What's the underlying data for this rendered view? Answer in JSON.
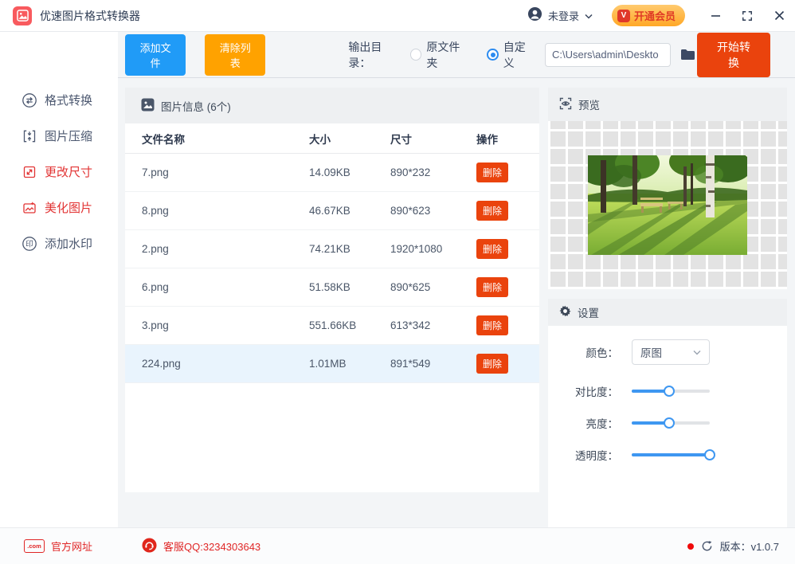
{
  "window": {
    "title": "优速图片格式转换器",
    "login_label": "未登录",
    "vip_label": "开通会员",
    "vip_icon_letter": "V"
  },
  "toolbar": {
    "add_files": "添加文件",
    "clear_list": "清除列表",
    "output_dir_label": "输出目录：",
    "radio_original": "原文件夹",
    "radio_custom": "自定义",
    "radio_selected": "自定义",
    "path_value": "C:\\Users\\admin\\Deskto",
    "start_button": "开始转换"
  },
  "sidebar": {
    "items": [
      {
        "label": "格式转换",
        "icon": "format-convert-icon",
        "highlighted": false
      },
      {
        "label": "图片压缩",
        "icon": "compress-icon",
        "highlighted": false
      },
      {
        "label": "更改尺寸",
        "icon": "resize-icon",
        "highlighted": true
      },
      {
        "label": "美化图片",
        "icon": "beautify-icon",
        "highlighted": true
      },
      {
        "label": "添加水印",
        "icon": "watermark-icon",
        "highlighted": false
      }
    ]
  },
  "table": {
    "panel_title": "图片信息 (6个)",
    "headers": [
      "文件名称",
      "大小",
      "尺寸",
      "操作"
    ],
    "delete_label": "删除",
    "rows": [
      {
        "name": "7.png",
        "size": "14.09KB",
        "dims": "890*232",
        "selected": false
      },
      {
        "name": "8.png",
        "size": "46.67KB",
        "dims": "890*623",
        "selected": false
      },
      {
        "name": "2.png",
        "size": "74.21KB",
        "dims": "1920*1080",
        "selected": false
      },
      {
        "name": "6.png",
        "size": "51.58KB",
        "dims": "890*625",
        "selected": false
      },
      {
        "name": "3.png",
        "size": "551.66KB",
        "dims": "613*342",
        "selected": false
      },
      {
        "name": "224.png",
        "size": "1.01MB",
        "dims": "891*549",
        "selected": true
      }
    ]
  },
  "preview": {
    "title": "预览"
  },
  "settings": {
    "title": "设置",
    "color_label": "颜色：",
    "color_value": "原图",
    "sliders": [
      {
        "label": "对比度：",
        "value": 48
      },
      {
        "label": "亮度：",
        "value": 48
      },
      {
        "label": "透明度：",
        "value": 100
      }
    ]
  },
  "footer": {
    "website": "官方网址",
    "qq": "客服QQ:3234303643",
    "version_label": "版本：v1.0.7"
  },
  "colors": {
    "accent_blue": "#209bf7",
    "accent_orange": "#ffa200",
    "accent_vermillion": "#ea430d",
    "sidebar_active_red": "#e23434",
    "selected_row_bg": "#e9f4fd",
    "slider_blue": "#3e97f1",
    "app_icon_red": "#f85a5e",
    "footer_red": "#e02626"
  }
}
